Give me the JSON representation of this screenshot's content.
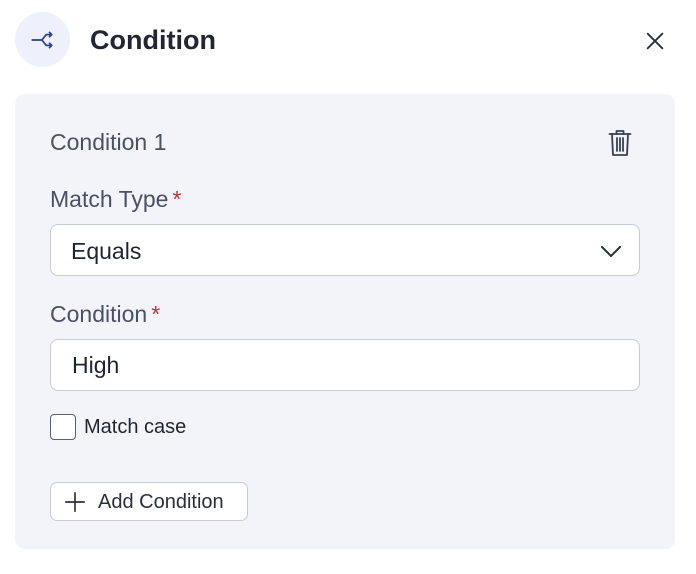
{
  "header": {
    "title": "Condition",
    "icon": "branch-split-icon",
    "close_icon": "close-icon"
  },
  "condition_block": {
    "title": "Condition 1",
    "delete_icon": "trash-icon",
    "match_type": {
      "label": "Match Type",
      "required_marker": "*",
      "selected": "Equals"
    },
    "condition": {
      "label": "Condition",
      "required_marker": "*",
      "value": "High"
    },
    "match_case": {
      "label": "Match case",
      "checked": false
    },
    "add_button": {
      "label": "Add Condition",
      "icon": "plus-icon"
    }
  },
  "colors": {
    "accent": "#2f3e8f",
    "required": "#c8312b",
    "panel_bg": "#f3f4f9",
    "icon_circle_bg": "#eef0fb"
  }
}
